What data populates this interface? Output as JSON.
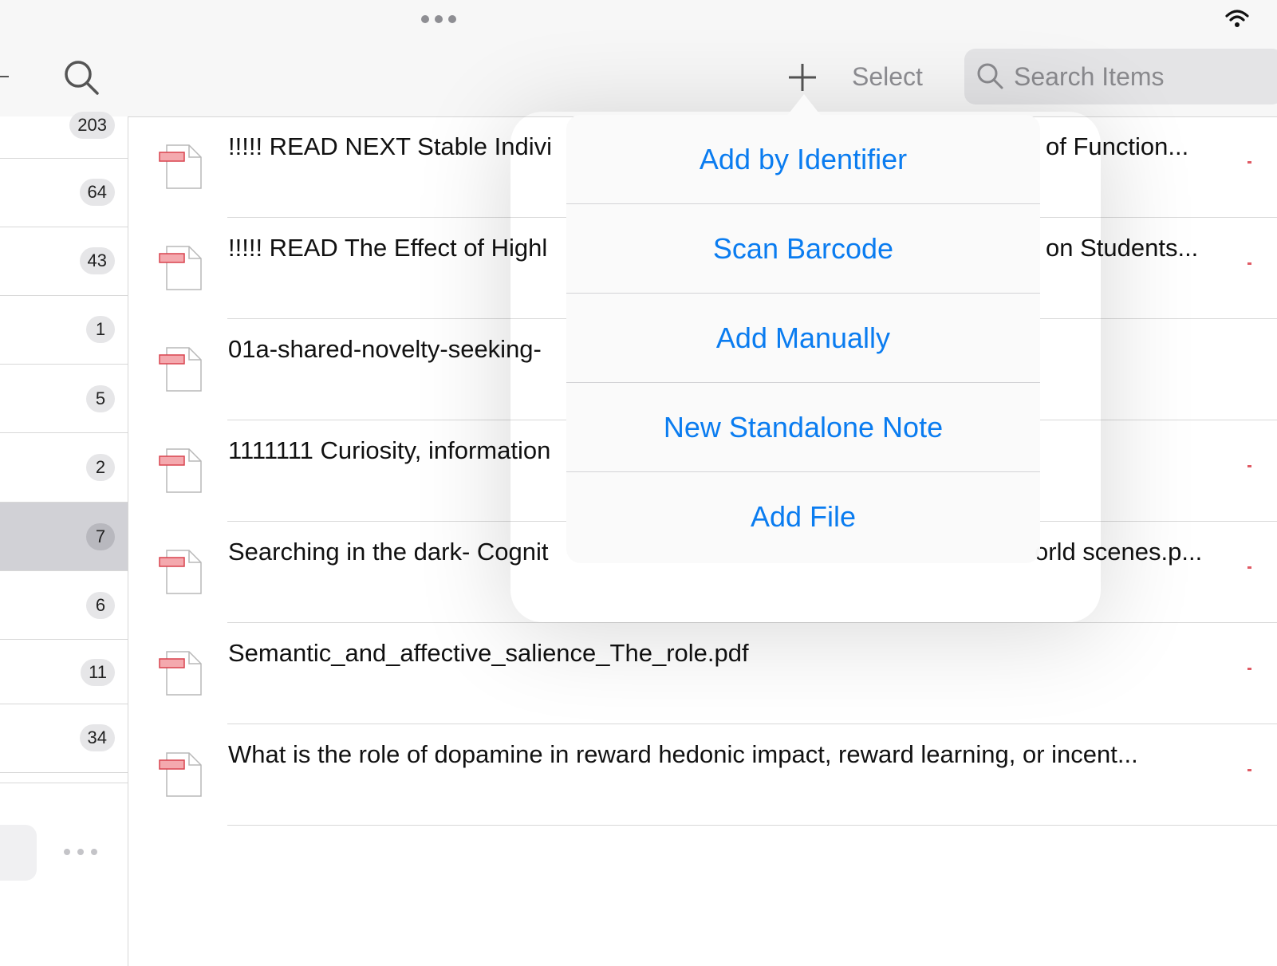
{
  "sidebar": {
    "badges": [
      "203",
      "64",
      "43",
      "1",
      "5",
      "2",
      "7",
      "6",
      "11",
      "34"
    ],
    "selected_index": 6
  },
  "toolbar": {
    "select_label": "Select",
    "search_placeholder": "Search Items"
  },
  "items": [
    {
      "title": "!!!!! READ NEXT Stable Indivi",
      "title_tail": "of Function..."
    },
    {
      "title": "!!!!! READ The Effect of Highl",
      "title_tail": "on Students..."
    },
    {
      "title": "01a-shared-novelty-seeking-",
      "title_tail": ""
    },
    {
      "title": "1111111 Curiosity, information",
      "title_tail": ""
    },
    {
      "title": "Searching in the dark- Cognit",
      "title_tail": "orld scenes.p..."
    },
    {
      "title": "Semantic_and_affective_salience_The_role.pdf",
      "title_tail": ""
    },
    {
      "title": "What is the role of dopamine in reward hedonic impact, reward learning, or incent...",
      "title_tail": ""
    }
  ],
  "add_menu": {
    "options": [
      "Add by Identifier",
      "Scan Barcode",
      "Add Manually",
      "New Standalone Note",
      "Add File"
    ]
  },
  "colors": {
    "accent": "#0a7cf0",
    "pdf_red": "#e05a64",
    "selected_row": "#d1d1d6"
  },
  "icons": {
    "sidebar_search": "search-icon",
    "add": "plus-icon",
    "search_field": "search-icon",
    "status": "wifi-icon",
    "multitask": "more-dots-icon",
    "item": "pdf-document-icon"
  }
}
